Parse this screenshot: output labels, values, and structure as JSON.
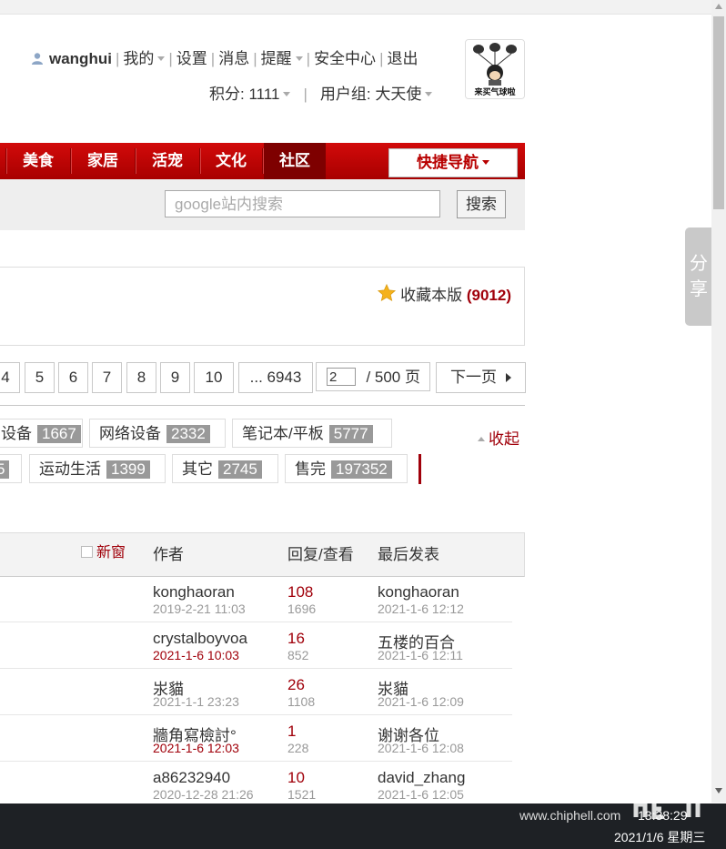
{
  "user": {
    "name": "wanghui",
    "links": [
      "我的",
      "设置",
      "消息",
      "提醒",
      "安全中心",
      "退出"
    ],
    "points_label": "积分: 1111",
    "group_label": "用户组: 大天使",
    "avatar_text": "来买气球啦"
  },
  "nav": {
    "items": [
      "美食",
      "家居",
      "活宠",
      "文化",
      "社区"
    ],
    "quick_nav": "快捷导航"
  },
  "search": {
    "placeholder": "google站内搜索",
    "button": "搜索"
  },
  "forum": {
    "favorite_label": "收藏本版",
    "favorite_count": "(9012)"
  },
  "pager": {
    "pages": [
      "4",
      "5",
      "6",
      "7",
      "8",
      "9",
      "10",
      "... 6943"
    ],
    "current": "2",
    "total": "/ 500 页",
    "next": "下一页"
  },
  "categories": {
    "row1": [
      {
        "label": "设备",
        "count": "1667"
      },
      {
        "label": "网络设备",
        "count": "2332"
      },
      {
        "label": "笔记本/平板",
        "count": "5777"
      }
    ],
    "row2": [
      {
        "label": "",
        "count": "5"
      },
      {
        "label": "运动生活",
        "count": "1399"
      },
      {
        "label": "其它",
        "count": "2745"
      },
      {
        "label": "售完",
        "count": "197352"
      }
    ],
    "collapse": "收起"
  },
  "table": {
    "new_window": "新窗",
    "headers": {
      "author": "作者",
      "replies": "回复/查看",
      "last": "最后发表"
    },
    "rows": [
      {
        "author": "konghaoran",
        "author_date": "2019-2-21 11:03",
        "replies": "108",
        "views": "1696",
        "last_user": "konghaoran",
        "last_date": "2021-1-6 12:12"
      },
      {
        "author": "crystalboyvoa",
        "author_date": "2021-1-6 10:03",
        "replies": "16",
        "views": "852",
        "last_user": "五楼的百合",
        "last_date": "2021-1-6 12:11"
      },
      {
        "author": "汖貓",
        "author_date": "2021-1-1 23:23",
        "replies": "26",
        "views": "1108",
        "last_user": "汖貓",
        "last_date": "2021-1-6 12:09"
      },
      {
        "author": "牆角寫檢討°",
        "author_date": "2021-1-6 12:03",
        "replies": "1",
        "views": "228",
        "last_user": "谢谢各位",
        "last_date": "2021-1-6 12:08"
      },
      {
        "author": "a86232940",
        "author_date": "2020-12-28 21:26",
        "replies": "10",
        "views": "1521",
        "last_user": "david_zhang",
        "last_date": "2021-1-6 12:05"
      }
    ]
  },
  "share": {
    "line1": "分",
    "line2": "享"
  },
  "taskbar": {
    "watermark": "www.chiphell.com",
    "time": "13:38:29",
    "date": "2021/1/6 星期三"
  }
}
